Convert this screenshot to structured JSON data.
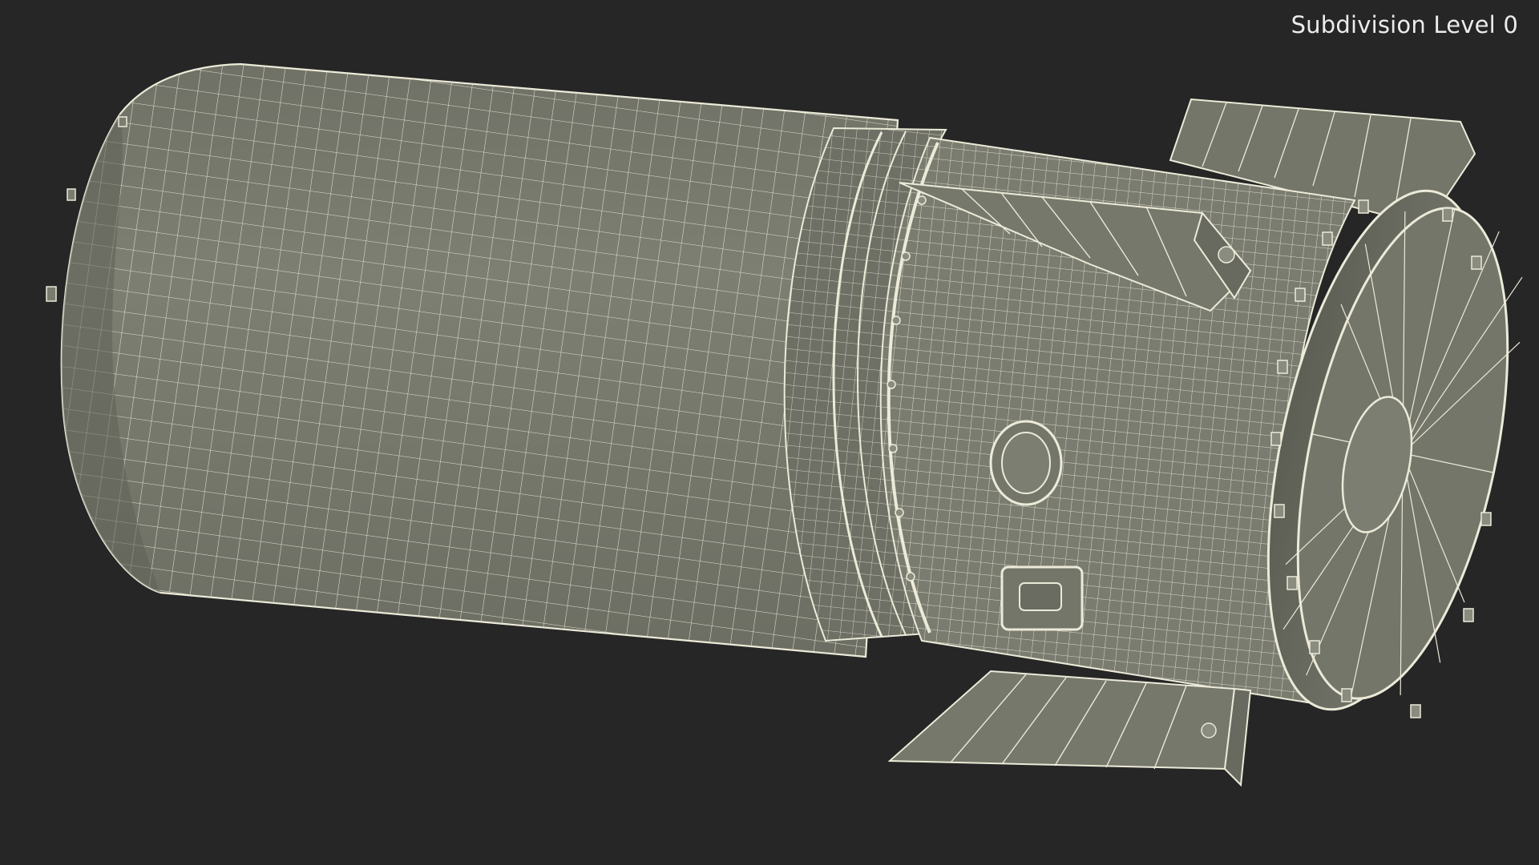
{
  "viewport": {
    "label": "Subdivision Level 0",
    "background_color": "#262626",
    "mesh_fill_color": "#787a6d",
    "mesh_shade_color": "#5f6157",
    "wire_color": "#e8e6d6",
    "object": "wireframe-cylinder-model"
  }
}
